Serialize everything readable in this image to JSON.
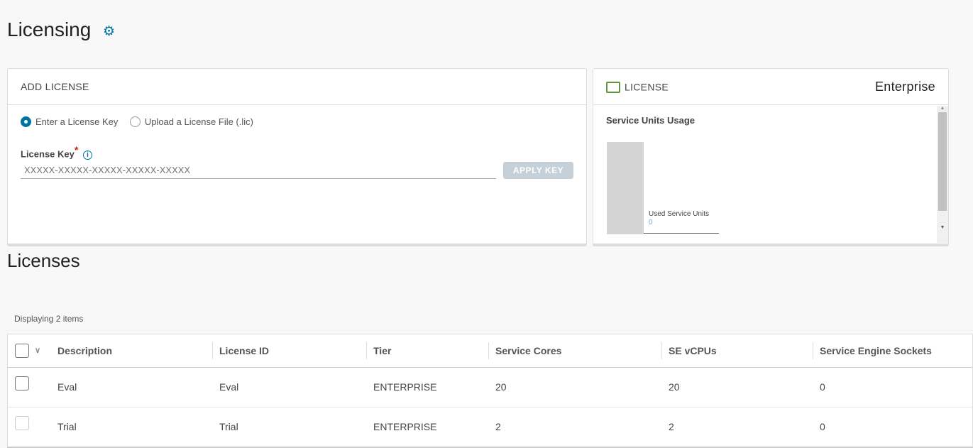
{
  "page": {
    "title": "Licensing",
    "settings_icon": "gear-icon"
  },
  "add_license": {
    "title": "ADD LICENSE",
    "options": [
      {
        "label": "Enter a License Key",
        "selected": true
      },
      {
        "label": "Upload a License File (.lic)",
        "selected": false
      }
    ],
    "field_label": "License Key",
    "required_mark": "*",
    "placeholder": "XXXXX-XXXXX-XXXXX-XXXXX-XXXXX",
    "value": "",
    "apply_label": "APPLY KEY"
  },
  "license_card": {
    "title": "LICENSE",
    "tier": "Enterprise",
    "usage_title": "Service Units Usage",
    "used_label": "Used Service Units",
    "used_value": "0"
  },
  "licenses": {
    "title": "Licenses",
    "count_text": "Displaying 2 items",
    "columns": [
      "Description",
      "License ID",
      "Tier",
      "Service Cores",
      "SE vCPUs",
      "Service Engine Sockets"
    ],
    "rows": [
      {
        "cells": [
          "Eval",
          "Eval",
          "ENTERPRISE",
          "20",
          "20",
          "0"
        ],
        "disabled": false
      },
      {
        "cells": [
          "Trial",
          "Trial",
          "ENTERPRISE",
          "2",
          "2",
          "0"
        ],
        "disabled": true
      }
    ]
  },
  "colors": {
    "accent": "#0072a3",
    "license_icon": "#5b9a3a",
    "required": "#c92100"
  }
}
